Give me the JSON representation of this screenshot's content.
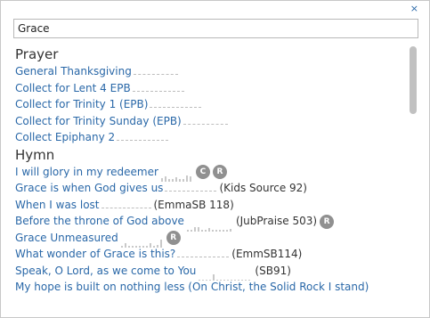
{
  "dialog": {
    "close_label": "×"
  },
  "search": {
    "value": "Grace"
  },
  "sections": {
    "prayer": {
      "heading": "Prayer",
      "items": [
        "General Thanksgiving",
        "Collect for Lent 4 EPB",
        "Collect for Trinity 1 (EPB)",
        "Collect for Trinity Sunday (EPB)",
        "Collect Epiphany 2"
      ]
    },
    "hymn": {
      "heading": "Hymn",
      "items": [
        {
          "title": "I will glory in my redeemer",
          "source": "",
          "badges": [
            "C",
            "R"
          ]
        },
        {
          "title": "Grace is when God gives us",
          "source": "(Kids Source 92)",
          "badges": []
        },
        {
          "title": "When I was lost",
          "source": "(EmmaSB 118)",
          "badges": []
        },
        {
          "title": "Before the throne of God above",
          "source": "(JubPraise 503)",
          "badges": [
            "R"
          ]
        },
        {
          "title": "Grace Unmeasured",
          "source": "",
          "badges": [
            "R"
          ]
        },
        {
          "title": "What wonder of Grace is this?",
          "source": "(EmmSB114)",
          "badges": []
        },
        {
          "title": "Speak, O Lord, as we come to You",
          "source": "(SB91)",
          "badges": []
        },
        {
          "title": "My hope is built on nothing less (On Christ, the Solid Rock I stand)",
          "source": "",
          "badges": []
        }
      ]
    }
  },
  "colors": {
    "link": "#2a68a8",
    "badge": "#909090"
  }
}
